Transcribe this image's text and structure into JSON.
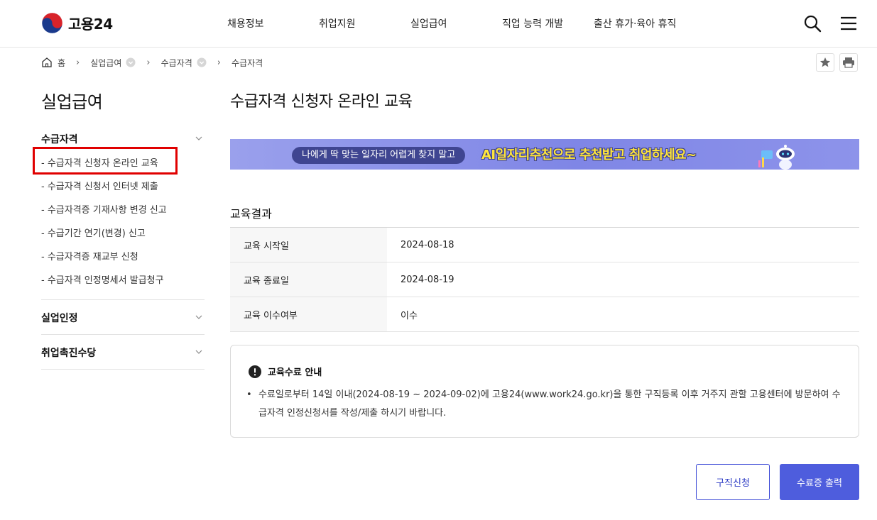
{
  "header": {
    "logo_text": "고용24",
    "nav": [
      "채용정보",
      "취업지원",
      "실업급여",
      "직업 능력 개발",
      "출산 휴가·육아 휴직"
    ]
  },
  "breadcrumb": {
    "home": "홈",
    "items": [
      "실업급여",
      "수급자격",
      "수급자격"
    ]
  },
  "sidebar": {
    "title": "실업급여",
    "groups": [
      {
        "label": "수급자격",
        "items": [
          "- 수급자격 신청자 온라인 교육",
          "- 수급자격 신청서 인터넷 제출",
          "- 수급자격증 기재사항 변경 신고",
          "- 수급기간 연기(변경) 신고",
          "- 수급자격증 재교부 신청",
          "- 수급자격 인정명세서 발급청구"
        ]
      },
      {
        "label": "실업인정"
      },
      {
        "label": "취업촉진수당"
      }
    ]
  },
  "main": {
    "title": "수급자격 신청자 온라인 교육",
    "banner": {
      "pill": "나에게 딱 맞는 일자리 어렵게 찾지 말고",
      "headline": "AI일자리추천으로 추천받고 취업하세요~"
    },
    "section_title": "교육결과",
    "rows": [
      {
        "label": "교육 시작일",
        "value": "2024-08-18"
      },
      {
        "label": "교육 종료일",
        "value": "2024-08-19"
      },
      {
        "label": "교육 이수여부",
        "value": "이수"
      }
    ],
    "notice": {
      "title": "교육수료 안내",
      "bullet": "•",
      "text": "수료일로부터 14일 이내(2024-08-19 ~ 2024-09-02)에 고용24(www.work24.go.kr)을 통한 구직등록 이후 거주지 관할 고용센터에 방문하여 수급자격 인정신청서를 작성/제출 하시기 바랍니다."
    },
    "buttons": {
      "job_apply": "구직신청",
      "print_cert": "수료증 출력"
    }
  },
  "colors": {
    "primary": "#4e5ddd",
    "highlight": "#e00000",
    "banner": "#8a90e8"
  }
}
